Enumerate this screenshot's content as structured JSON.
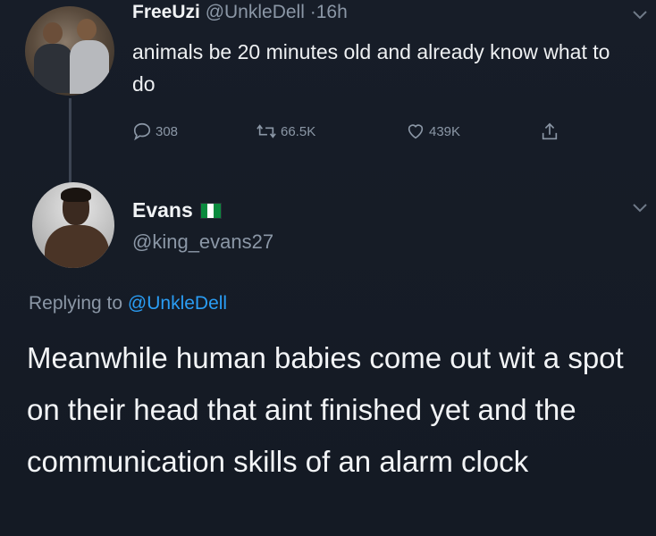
{
  "parent_tweet": {
    "display_name": "FreeUzi",
    "handle": "@UnkleDell",
    "separator": "·",
    "time": "16h",
    "text": "animals be 20 minutes old and already know what to do",
    "reply_count": "308",
    "retweet_count": "66.5K",
    "like_count": "439K"
  },
  "reply_tweet": {
    "display_name": "Evans",
    "handle": "@king_evans27",
    "replying_prefix": "Replying to",
    "replying_to": "@UnkleDell",
    "text": "Meanwhile human babies come out wit a spot on their head that aint finished yet and the communication skills of an alarm clock"
  },
  "icons": {
    "reply": "reply-icon",
    "retweet": "retweet-icon",
    "like": "heart-icon",
    "share": "share-icon",
    "more": "chevron-down-icon",
    "flag": "nigeria-flag-icon"
  },
  "colors": {
    "background": "#151b25",
    "text": "#eef0f2",
    "muted": "#8b97a6",
    "link": "#2a9df4"
  }
}
